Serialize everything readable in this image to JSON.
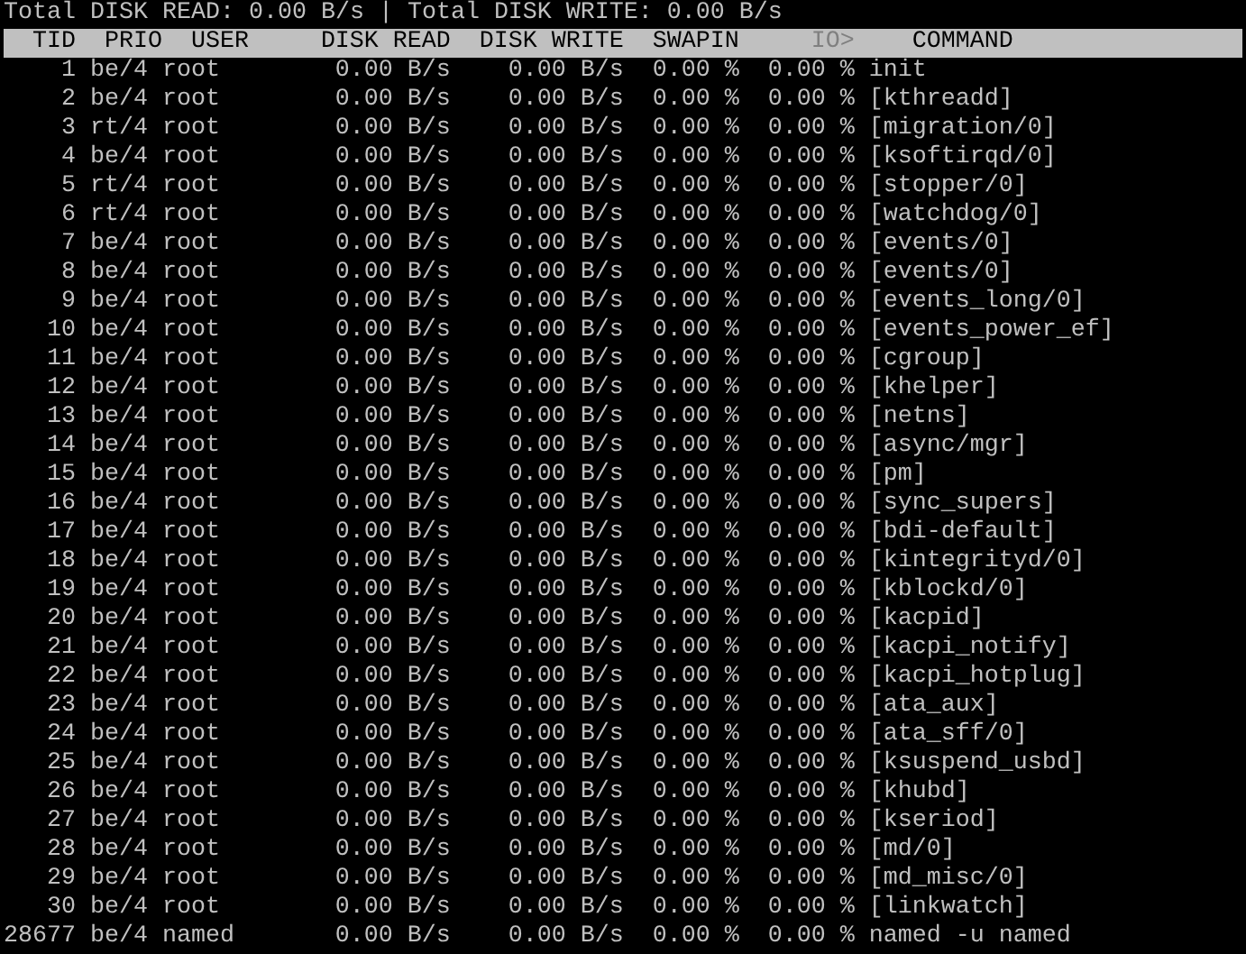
{
  "summary": "Total DISK READ: 0.00 B/s | Total DISK WRITE: 0.00 B/s",
  "columns": [
    {
      "label": "TID",
      "sorted": false
    },
    {
      "label": "PRIO",
      "sorted": false
    },
    {
      "label": "USER",
      "sorted": false
    },
    {
      "label": "DISK READ",
      "sorted": false
    },
    {
      "label": "DISK WRITE",
      "sorted": false
    },
    {
      "label": "SWAPIN",
      "sorted": false
    },
    {
      "label": "IO>",
      "sorted": true
    },
    {
      "label": "COMMAND",
      "sorted": false
    }
  ],
  "rows": [
    {
      "tid": "1",
      "prio": "be/4",
      "user": "root",
      "disk_read": "0.00 B/s",
      "disk_write": "0.00 B/s",
      "swapin": "0.00 %",
      "io": "0.00 %",
      "command": "init"
    },
    {
      "tid": "2",
      "prio": "be/4",
      "user": "root",
      "disk_read": "0.00 B/s",
      "disk_write": "0.00 B/s",
      "swapin": "0.00 %",
      "io": "0.00 %",
      "command": "[kthreadd]"
    },
    {
      "tid": "3",
      "prio": "rt/4",
      "user": "root",
      "disk_read": "0.00 B/s",
      "disk_write": "0.00 B/s",
      "swapin": "0.00 %",
      "io": "0.00 %",
      "command": "[migration/0]"
    },
    {
      "tid": "4",
      "prio": "be/4",
      "user": "root",
      "disk_read": "0.00 B/s",
      "disk_write": "0.00 B/s",
      "swapin": "0.00 %",
      "io": "0.00 %",
      "command": "[ksoftirqd/0]"
    },
    {
      "tid": "5",
      "prio": "rt/4",
      "user": "root",
      "disk_read": "0.00 B/s",
      "disk_write": "0.00 B/s",
      "swapin": "0.00 %",
      "io": "0.00 %",
      "command": "[stopper/0]"
    },
    {
      "tid": "6",
      "prio": "rt/4",
      "user": "root",
      "disk_read": "0.00 B/s",
      "disk_write": "0.00 B/s",
      "swapin": "0.00 %",
      "io": "0.00 %",
      "command": "[watchdog/0]"
    },
    {
      "tid": "7",
      "prio": "be/4",
      "user": "root",
      "disk_read": "0.00 B/s",
      "disk_write": "0.00 B/s",
      "swapin": "0.00 %",
      "io": "0.00 %",
      "command": "[events/0]"
    },
    {
      "tid": "8",
      "prio": "be/4",
      "user": "root",
      "disk_read": "0.00 B/s",
      "disk_write": "0.00 B/s",
      "swapin": "0.00 %",
      "io": "0.00 %",
      "command": "[events/0]"
    },
    {
      "tid": "9",
      "prio": "be/4",
      "user": "root",
      "disk_read": "0.00 B/s",
      "disk_write": "0.00 B/s",
      "swapin": "0.00 %",
      "io": "0.00 %",
      "command": "[events_long/0]"
    },
    {
      "tid": "10",
      "prio": "be/4",
      "user": "root",
      "disk_read": "0.00 B/s",
      "disk_write": "0.00 B/s",
      "swapin": "0.00 %",
      "io": "0.00 %",
      "command": "[events_power_ef]"
    },
    {
      "tid": "11",
      "prio": "be/4",
      "user": "root",
      "disk_read": "0.00 B/s",
      "disk_write": "0.00 B/s",
      "swapin": "0.00 %",
      "io": "0.00 %",
      "command": "[cgroup]"
    },
    {
      "tid": "12",
      "prio": "be/4",
      "user": "root",
      "disk_read": "0.00 B/s",
      "disk_write": "0.00 B/s",
      "swapin": "0.00 %",
      "io": "0.00 %",
      "command": "[khelper]"
    },
    {
      "tid": "13",
      "prio": "be/4",
      "user": "root",
      "disk_read": "0.00 B/s",
      "disk_write": "0.00 B/s",
      "swapin": "0.00 %",
      "io": "0.00 %",
      "command": "[netns]"
    },
    {
      "tid": "14",
      "prio": "be/4",
      "user": "root",
      "disk_read": "0.00 B/s",
      "disk_write": "0.00 B/s",
      "swapin": "0.00 %",
      "io": "0.00 %",
      "command": "[async/mgr]"
    },
    {
      "tid": "15",
      "prio": "be/4",
      "user": "root",
      "disk_read": "0.00 B/s",
      "disk_write": "0.00 B/s",
      "swapin": "0.00 %",
      "io": "0.00 %",
      "command": "[pm]"
    },
    {
      "tid": "16",
      "prio": "be/4",
      "user": "root",
      "disk_read": "0.00 B/s",
      "disk_write": "0.00 B/s",
      "swapin": "0.00 %",
      "io": "0.00 %",
      "command": "[sync_supers]"
    },
    {
      "tid": "17",
      "prio": "be/4",
      "user": "root",
      "disk_read": "0.00 B/s",
      "disk_write": "0.00 B/s",
      "swapin": "0.00 %",
      "io": "0.00 %",
      "command": "[bdi-default]"
    },
    {
      "tid": "18",
      "prio": "be/4",
      "user": "root",
      "disk_read": "0.00 B/s",
      "disk_write": "0.00 B/s",
      "swapin": "0.00 %",
      "io": "0.00 %",
      "command": "[kintegrityd/0]"
    },
    {
      "tid": "19",
      "prio": "be/4",
      "user": "root",
      "disk_read": "0.00 B/s",
      "disk_write": "0.00 B/s",
      "swapin": "0.00 %",
      "io": "0.00 %",
      "command": "[kblockd/0]"
    },
    {
      "tid": "20",
      "prio": "be/4",
      "user": "root",
      "disk_read": "0.00 B/s",
      "disk_write": "0.00 B/s",
      "swapin": "0.00 %",
      "io": "0.00 %",
      "command": "[kacpid]"
    },
    {
      "tid": "21",
      "prio": "be/4",
      "user": "root",
      "disk_read": "0.00 B/s",
      "disk_write": "0.00 B/s",
      "swapin": "0.00 %",
      "io": "0.00 %",
      "command": "[kacpi_notify]"
    },
    {
      "tid": "22",
      "prio": "be/4",
      "user": "root",
      "disk_read": "0.00 B/s",
      "disk_write": "0.00 B/s",
      "swapin": "0.00 %",
      "io": "0.00 %",
      "command": "[kacpi_hotplug]"
    },
    {
      "tid": "23",
      "prio": "be/4",
      "user": "root",
      "disk_read": "0.00 B/s",
      "disk_write": "0.00 B/s",
      "swapin": "0.00 %",
      "io": "0.00 %",
      "command": "[ata_aux]"
    },
    {
      "tid": "24",
      "prio": "be/4",
      "user": "root",
      "disk_read": "0.00 B/s",
      "disk_write": "0.00 B/s",
      "swapin": "0.00 %",
      "io": "0.00 %",
      "command": "[ata_sff/0]"
    },
    {
      "tid": "25",
      "prio": "be/4",
      "user": "root",
      "disk_read": "0.00 B/s",
      "disk_write": "0.00 B/s",
      "swapin": "0.00 %",
      "io": "0.00 %",
      "command": "[ksuspend_usbd]"
    },
    {
      "tid": "26",
      "prio": "be/4",
      "user": "root",
      "disk_read": "0.00 B/s",
      "disk_write": "0.00 B/s",
      "swapin": "0.00 %",
      "io": "0.00 %",
      "command": "[khubd]"
    },
    {
      "tid": "27",
      "prio": "be/4",
      "user": "root",
      "disk_read": "0.00 B/s",
      "disk_write": "0.00 B/s",
      "swapin": "0.00 %",
      "io": "0.00 %",
      "command": "[kseriod]"
    },
    {
      "tid": "28",
      "prio": "be/4",
      "user": "root",
      "disk_read": "0.00 B/s",
      "disk_write": "0.00 B/s",
      "swapin": "0.00 %",
      "io": "0.00 %",
      "command": "[md/0]"
    },
    {
      "tid": "29",
      "prio": "be/4",
      "user": "root",
      "disk_read": "0.00 B/s",
      "disk_write": "0.00 B/s",
      "swapin": "0.00 %",
      "io": "0.00 %",
      "command": "[md_misc/0]"
    },
    {
      "tid": "30",
      "prio": "be/4",
      "user": "root",
      "disk_read": "0.00 B/s",
      "disk_write": "0.00 B/s",
      "swapin": "0.00 %",
      "io": "0.00 %",
      "command": "[linkwatch]"
    },
    {
      "tid": "28677",
      "prio": "be/4",
      "user": "named",
      "disk_read": "0.00 B/s",
      "disk_write": "0.00 B/s",
      "swapin": "0.00 %",
      "io": "0.00 %",
      "command": "named -u named"
    }
  ]
}
